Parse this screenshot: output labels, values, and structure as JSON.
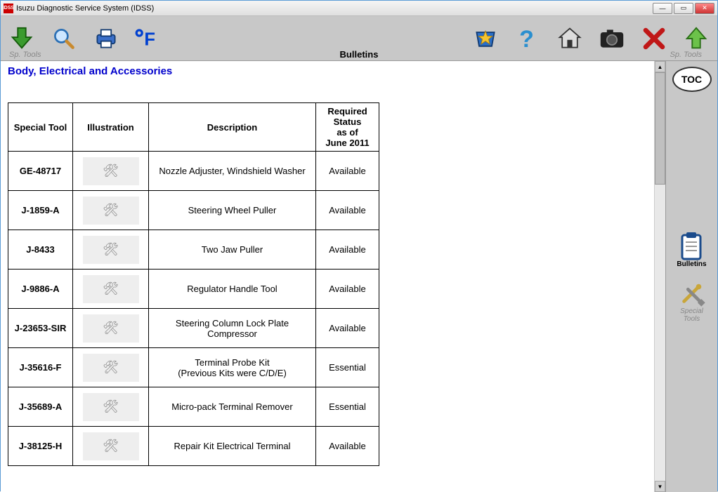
{
  "app": {
    "icon_text": "IDSS",
    "title": "Isuzu Diagnostic Service System (IDSS)"
  },
  "toolbar": {
    "sp_left": "Sp. Tools",
    "sp_right": "Sp. Tools",
    "center_title": "Bulletins"
  },
  "right_panel": {
    "toc": "TOC",
    "bulletins": "Bulletins",
    "special_tools": "Special\nTools"
  },
  "page": {
    "heading": "Body, Electrical and Accessories",
    "columns": {
      "tool": "Special Tool",
      "illustration": "Illustration",
      "description": "Description",
      "status": "Required\nStatus\nas of\nJune 2011"
    },
    "rows": [
      {
        "tool": "GE-48717",
        "desc": "Nozzle Adjuster, Windshield Washer",
        "status": "Available"
      },
      {
        "tool": "J-1859-A",
        "desc": "Steering Wheel Puller",
        "status": "Available"
      },
      {
        "tool": "J-8433",
        "desc": "Two Jaw Puller",
        "status": "Available"
      },
      {
        "tool": "J-9886-A",
        "desc": "Regulator Handle Tool",
        "status": "Available"
      },
      {
        "tool": "J-23653-SIR",
        "desc": "Steering Column Lock Plate\nCompressor",
        "status": "Available"
      },
      {
        "tool": "J-35616-F",
        "desc": "Terminal Probe Kit\n(Previous Kits were C/D/E)",
        "status": "Essential"
      },
      {
        "tool": "J-35689-A",
        "desc": "Micro-pack Terminal Remover",
        "status": "Essential"
      },
      {
        "tool": "J-38125-H",
        "desc": "Repair Kit Electrical Terminal",
        "status": "Available"
      }
    ]
  }
}
